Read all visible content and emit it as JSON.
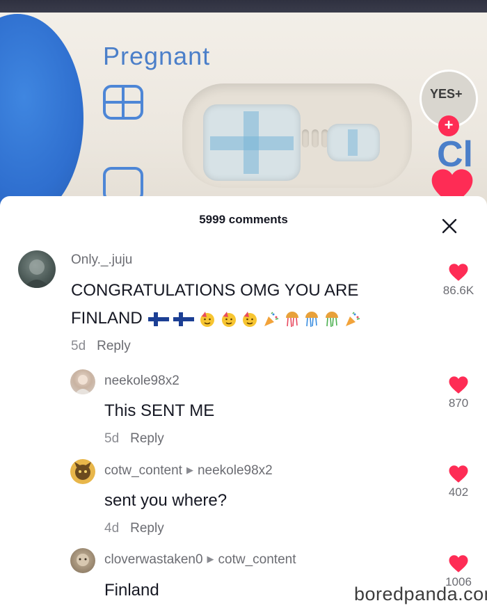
{
  "video": {
    "test_brand_word": "Pregnant",
    "badge_text": "YES+",
    "follow_symbol": "+",
    "partial_word": "Cl"
  },
  "comments_sheet": {
    "title": "5999 comments",
    "close_icon": "close-icon",
    "comments": [
      {
        "username": "Only._.juju",
        "text_line1": "CONGRATULATIONS OMG YOU ARE",
        "text_line2": "FINLAND",
        "emojis": [
          "finland-flag",
          "finland-flag",
          "party-face",
          "party-face",
          "party-face",
          "party-popper",
          "confetti-ball",
          "confetti-ball",
          "confetti-ball",
          "party-popper"
        ],
        "age": "5d",
        "reply_label": "Reply",
        "likes": "86.6K"
      },
      {
        "username": "neekole98x2",
        "text": "This SENT ME",
        "age": "5d",
        "reply_label": "Reply",
        "likes": "870"
      },
      {
        "username": "cotw_content",
        "reply_to": "neekole98x2",
        "text": "sent you where?",
        "age": "4d",
        "reply_label": "Reply",
        "likes": "402"
      },
      {
        "username": "cloverwastaken0",
        "reply_to": "cotw_content",
        "text": "Finland",
        "likes": "1006"
      }
    ]
  },
  "colors": {
    "like_red": "#fe2c55",
    "text_dark": "#161823",
    "text_muted": "#8a8b91"
  },
  "watermark": "boredpanda.com"
}
